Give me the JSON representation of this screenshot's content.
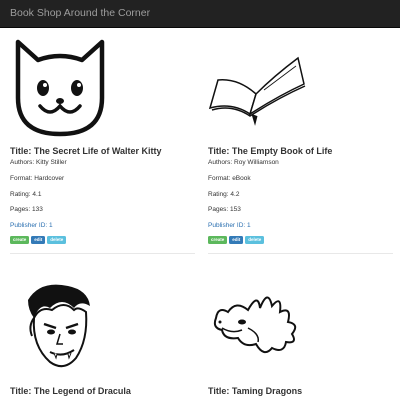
{
  "navbar": {
    "brand": "Book Shop Around the Corner"
  },
  "labels": {
    "authors": "Authors:",
    "format": "Format:",
    "rating": "Rating:",
    "pages": "Pages:",
    "publisher": "Publisher ID:",
    "title": "Title:"
  },
  "actions": {
    "create": "create",
    "edit": "edit",
    "delete": "delete"
  },
  "books": [
    {
      "title": "Title: The Secret Life of Walter Kitty",
      "authors": "Authors: Kitty Stiller",
      "format": "Format: Hardcover",
      "rating": "Rating: 4.1",
      "pages": "Pages: 133",
      "publisher": "Publisher ID: 1",
      "icon": "cat-face-icon"
    },
    {
      "title": "Title: The Empty Book of Life",
      "authors": "Authors: Roy Williamson",
      "format": "Format: eBook",
      "rating": "Rating: 4.2",
      "pages": "Pages: 153",
      "publisher": "Publisher ID: 1",
      "icon": "open-book-icon"
    },
    {
      "title": "Title: The Legend of Dracula",
      "icon": "dracula-face-icon"
    },
    {
      "title": "Title: Taming Dragons",
      "icon": "dragon-head-icon"
    }
  ],
  "colors": {
    "navbar_bg": "#222222",
    "link": "#2a6fb0",
    "create": "#5cb85c",
    "edit": "#337ab7",
    "delete": "#5bc0de"
  }
}
